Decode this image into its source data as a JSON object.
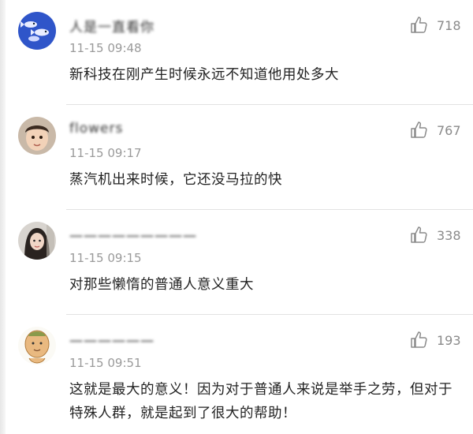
{
  "comments": [
    {
      "username": "人是一直看你",
      "time": "11-15 09:48",
      "text": "新科技在刚产生时候永远不知道他用处多大",
      "likes": "718",
      "avatar": "blue-fish-avatar"
    },
    {
      "username": "flowers",
      "time": "11-15 09:17",
      "text": "蒸汽机出来时候，它还没马拉的快",
      "likes": "767",
      "avatar": "child-photo-avatar"
    },
    {
      "username": "一一一一一一一一一",
      "time": "11-15 09:15",
      "text": "对那些懒惰的普通人意义重大",
      "likes": "338",
      "avatar": "woman-photo-avatar"
    },
    {
      "username": "一一一一一一",
      "time": "11-15 09:51",
      "text": "这就是最大的意义！因为对于普通人来说是举手之劳，但对于特殊人群，就是起到了很大的帮助！",
      "likes": "193",
      "avatar": "cartoon-avatar"
    }
  ],
  "colors": {
    "text": "#222222",
    "meta": "#9a9a9a",
    "like_icon": "#8a8a8a",
    "divider": "#e2e2e2"
  }
}
